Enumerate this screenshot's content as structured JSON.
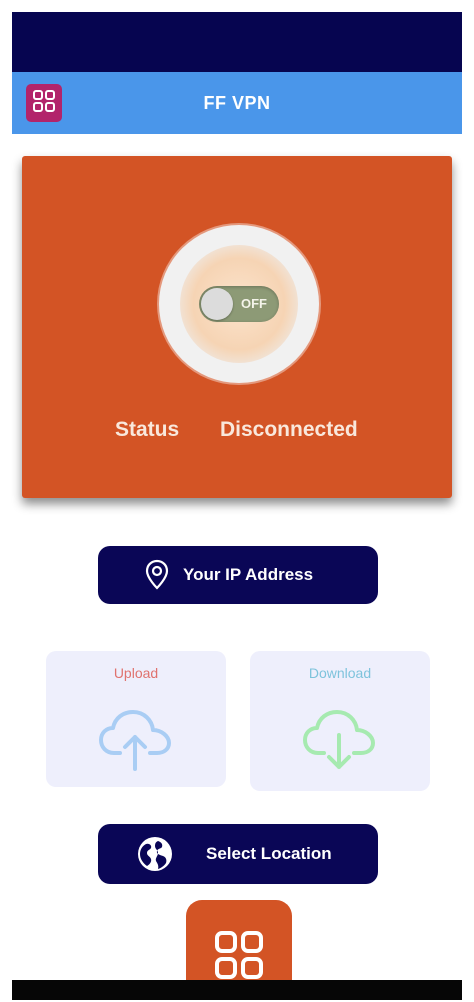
{
  "app_bar": {
    "title": "FF VPN",
    "menu_icon": "grid-icon"
  },
  "status_card": {
    "switch_text": "OFF",
    "status_label": "Status",
    "status_value": "Disconnected"
  },
  "ip_button": {
    "label": "Your IP Address",
    "icon": "location-pin-icon"
  },
  "upload": {
    "label": "Upload",
    "icon": "cloud-upload-icon"
  },
  "download": {
    "label": "Download",
    "icon": "cloud-download-icon"
  },
  "location_button": {
    "label": "Select Location",
    "icon": "globe-icon"
  },
  "bottom_button": {
    "icon": "grid-icon"
  },
  "colors": {
    "status_bar": "#060550",
    "app_bar": "#4a96ea",
    "accent_orange": "#d35425",
    "button_navy": "#0a0656",
    "menu_magenta": "#b2246b"
  }
}
